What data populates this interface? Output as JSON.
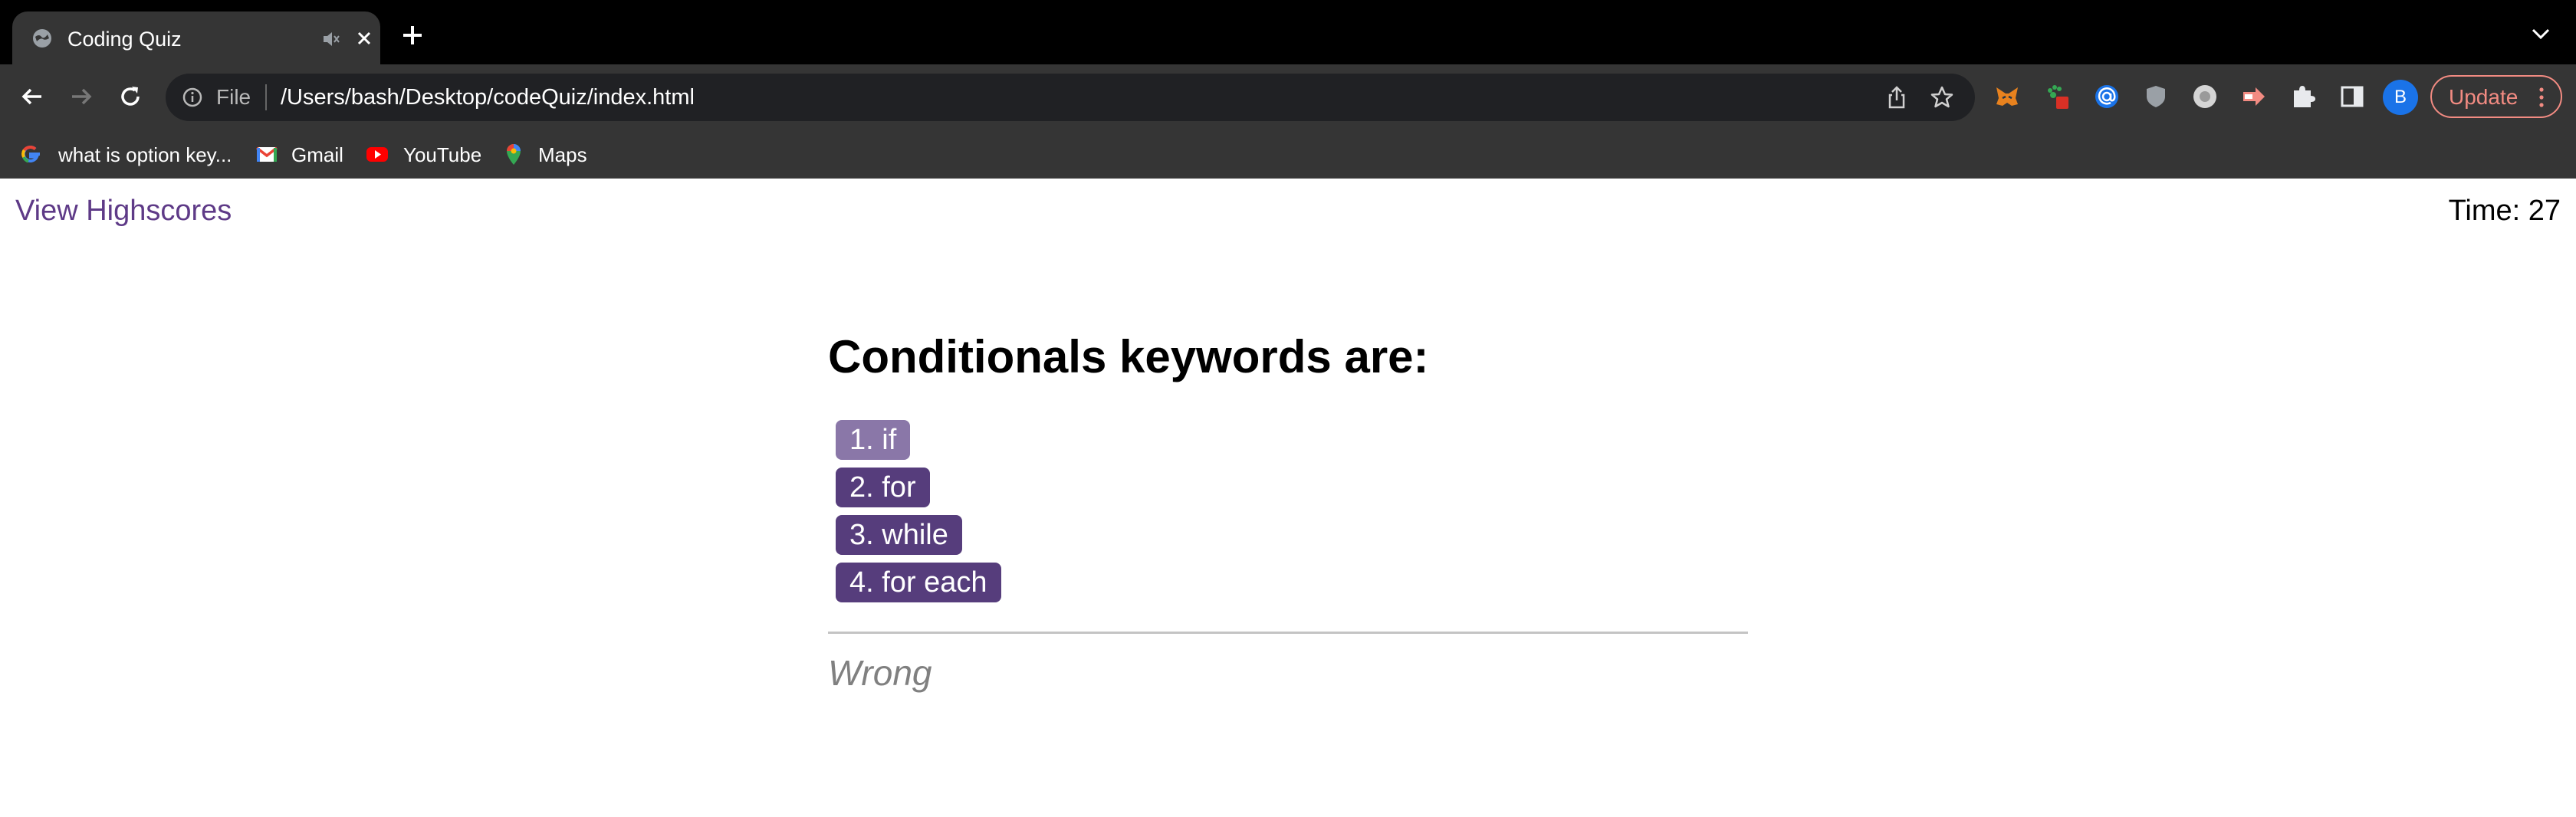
{
  "browser": {
    "tab": {
      "title": "Coding Quiz"
    },
    "omnibox": {
      "scheme": "File",
      "url": "/Users/bash/Desktop/codeQuiz/index.html"
    },
    "update_label": "Update",
    "profile_initial": "B",
    "bookmarks": [
      {
        "label": "what is option key...",
        "icon": "google-icon"
      },
      {
        "label": "Gmail",
        "icon": "gmail-icon"
      },
      {
        "label": "YouTube",
        "icon": "youtube-icon"
      },
      {
        "label": "Maps",
        "icon": "maps-icon"
      }
    ],
    "extensions": [
      "metamask-icon",
      "paw-extension-icon",
      "at-extension-icon",
      "shield-extension-icon",
      "circle-extension-icon",
      "arrow-extension-icon",
      "puzzle-icon",
      "side-panel-icon"
    ]
  },
  "page": {
    "highscores_link": "View Highscores",
    "timer": "Time: 27",
    "question": "Conditionals keywords are:",
    "choices": [
      {
        "label": "1. if",
        "color": "#8a77a8"
      },
      {
        "label": "2. for",
        "color": "#563d7c"
      },
      {
        "label": "3. while",
        "color": "#563d7c"
      },
      {
        "label": "4. for each",
        "color": "#563d7c"
      }
    ],
    "feedback": "Wrong"
  },
  "colors": {
    "accent": "#563d7c",
    "accent_hover": "#8a77a8",
    "link": "#5e3a87",
    "update_border": "#f28b82"
  }
}
